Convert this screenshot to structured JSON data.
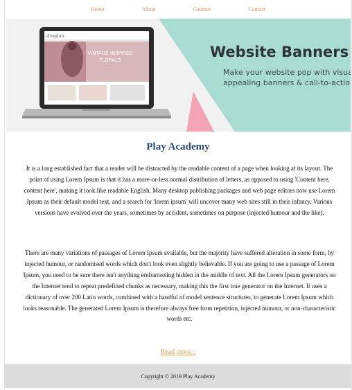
{
  "nav": {
    "items": [
      {
        "label": "Home"
      },
      {
        "label": "About"
      },
      {
        "label": "Courses"
      },
      {
        "label": "Contact"
      }
    ]
  },
  "banner": {
    "title": "Website Banners",
    "subtitle_line1": "Make your website pop with visually",
    "subtitle_line2": "appealing banners & call-to-actions",
    "screen_logo": "Aroshan",
    "screen_headline_1": "VINTAGE INSPIRED",
    "screen_headline_2": "FLORALS"
  },
  "main": {
    "title": "Play Academy",
    "paragraph_1": "It is a long established fact that a reader will be distracted by the readable content of a page when looking at its layout. The point of using Lorem Ipsum is that it has a more-or-less normal distribution of letters, as opposed to using 'Content here, content here', making it look like readable English. Many desktop publishing packages and web page editors now use Lorem Ipsum as their default model text, and a search for 'lorem ipsum' will uncover many web sites still in their infancy. Various versions have evolved over the years, sometimes by accident, sometimes on purpose (injected humour and the like).",
    "paragraph_2": "There are many variations of passages of Lorem Ipsum available, but the majority have suffered alteration in some form, by injected humour, or randomised words which don't look even slightly believable. If you are going to use a passage of Lorem Ipsum, you need to be sure there isn't anything embarrassing hidden in the middle of text. All the Lorem Ipsum generators on the Internet tend to repeat predefined chunks as necessary, making this the first true generator on the Internet. It uses a dictionary of over 200 Latin words, combined with a handful of model sentence structures, to generate Lorem Ipsum which looks reasonable. The generated Lorem Ipsum is therefore always free from repetition, injected humour, or non-characteristic words etc.",
    "read_more": "Read more..."
  },
  "footer": {
    "copyright": "Copyright © 2019 Play Academy"
  },
  "colors": {
    "nav_link": "#e08e6a",
    "title": "#2b4a78",
    "read_more": "#d9a04a",
    "footer_bg": "#dcdcdc",
    "banner_teal": "#a9dcd2",
    "banner_pink": "#f4a3b4"
  }
}
